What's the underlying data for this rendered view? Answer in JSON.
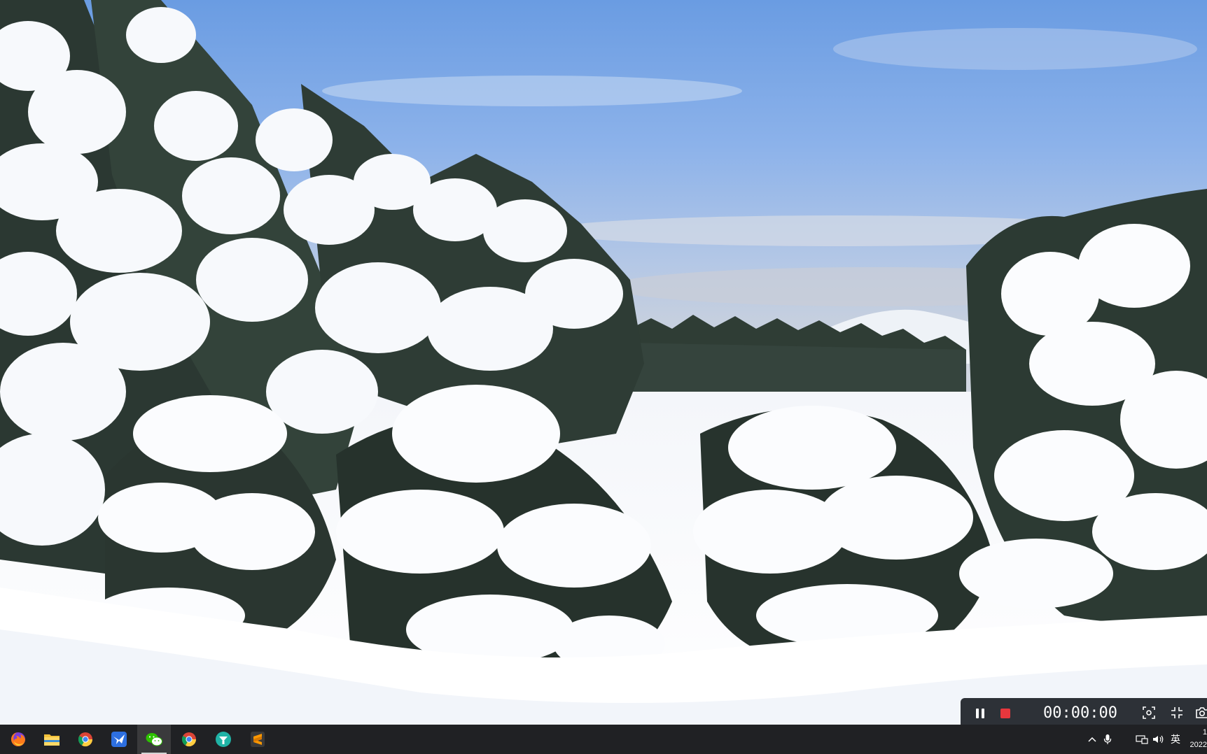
{
  "recorder": {
    "elapsed_time": "00:00:00"
  },
  "taskbar": {
    "apps": [
      {
        "name": "firefox-icon"
      },
      {
        "name": "file-explorer-icon"
      },
      {
        "name": "chrome-icon"
      },
      {
        "name": "bird-app-icon"
      },
      {
        "name": "wechat-icon"
      },
      {
        "name": "chrome-icon"
      },
      {
        "name": "teal-app-icon"
      },
      {
        "name": "sublime-text-icon"
      }
    ],
    "tray": {
      "input_method": "英"
    },
    "clock": {
      "time": "1",
      "date": "2022"
    }
  }
}
